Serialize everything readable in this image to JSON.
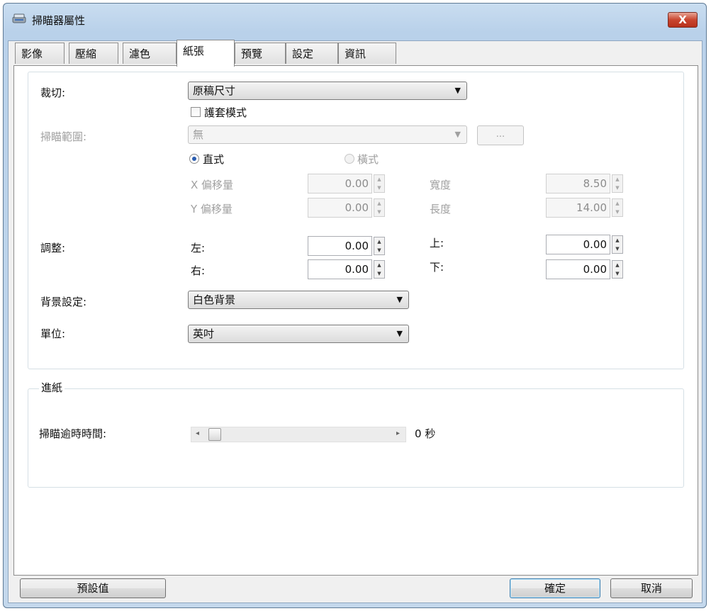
{
  "window": {
    "title": "掃瞄器屬性",
    "close_label": "X"
  },
  "tabs": [
    {
      "label": "影像"
    },
    {
      "label": "壓縮"
    },
    {
      "label": "濾色"
    },
    {
      "label": "紙張",
      "active": true
    },
    {
      "label": "預覽"
    },
    {
      "label": "設定"
    },
    {
      "label": "資訊"
    }
  ],
  "crop": {
    "label": "裁切:",
    "value": "原稿尺寸"
  },
  "carrier": {
    "label": "護套模式",
    "checked": false
  },
  "scan_area": {
    "label": "掃瞄範圍:",
    "value": "無",
    "browse_label": "..."
  },
  "orientation": {
    "portrait": "直式",
    "landscape": "橫式",
    "selected": "portrait"
  },
  "offsets": {
    "x_label": "X 偏移量",
    "x_value": "0.00",
    "y_label": "Y 偏移量",
    "y_value": "0.00",
    "width_label": "寬度",
    "width_value": "8.50",
    "length_label": "長度",
    "length_value": "14.00"
  },
  "adjust": {
    "label": "調整:",
    "left_label": "左:",
    "left_value": "0.00",
    "right_label": "右:",
    "right_value": "0.00",
    "top_label": "上:",
    "top_value": "0.00",
    "bottom_label": "下:",
    "bottom_value": "0.00"
  },
  "background": {
    "label": "背景設定:",
    "value": "白色背景"
  },
  "unit": {
    "label": "單位:",
    "value": "英吋"
  },
  "feeding": {
    "title": "進紙",
    "timeout_label": "掃瞄逾時時間:",
    "timeout_value": "0",
    "timeout_unit": "秒"
  },
  "buttons": {
    "default": "預設值",
    "ok": "確定",
    "cancel": "取消"
  },
  "colors": {
    "title_bar": "#b9d1ea",
    "close_button": "#c9452f",
    "panel": "#ffffff",
    "radio_dot": "#2a5db0"
  }
}
